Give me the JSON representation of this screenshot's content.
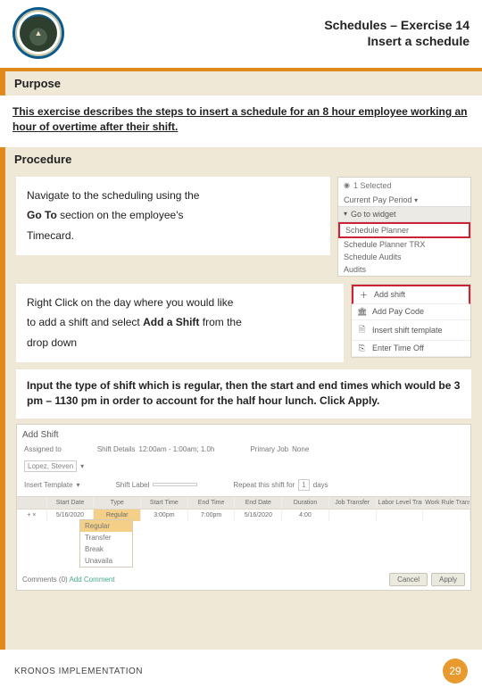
{
  "header": {
    "title_line1": "Schedules – Exercise 14",
    "title_line2": "Insert a schedule"
  },
  "sections": {
    "purpose_label": "Purpose",
    "purpose_text": "This exercise describes the steps to insert a schedule for an 8 hour employee working an hour of overtime after their shift.",
    "procedure_label": "Procedure"
  },
  "steps": {
    "s1a": "Navigate to the scheduling using the",
    "s1b": "Go To",
    "s1c": " section on the employee's",
    "s1d": "Timecard.",
    "s2a": "Right Click on the day where you would like",
    "s2b": "to add a shift and select ",
    "s2c": "Add a Shift",
    "s2d": " from the",
    "s2e": "drop down",
    "s3": "Input the type of shift which is regular, then the start and end times which would be 3 pm – 1130 pm in order to account for the half hour lunch. Click Apply."
  },
  "ss1": {
    "selected": "1 Selected",
    "period": "Current Pay Period",
    "goto": "Go to widget",
    "items": [
      "Schedule Planner",
      "Schedule Planner TRX",
      "Schedule Audits",
      "Audits"
    ]
  },
  "ss2": {
    "items": [
      {
        "icon": "＋",
        "label": "Add shift"
      },
      {
        "icon": "🏛",
        "label": "Add Pay Code"
      },
      {
        "icon": "🗎",
        "label": "Insert shift template"
      },
      {
        "icon": "⎘",
        "label": "Enter Time Off"
      }
    ]
  },
  "ss3": {
    "title": "Add Shift",
    "assigned_label": "Assigned to",
    "assigned_value": "Lopez, Steven",
    "details_label": "Shift Details",
    "details_value": "12:00am - 1:00am; 1.0h",
    "primary_label": "Primary Job",
    "primary_value": "None",
    "template_label": "Insert Template",
    "shift_label_lbl": "Shift Label",
    "repeat_label": "Repeat this shift for",
    "repeat_value": "1",
    "days": "days",
    "cols": [
      "",
      "Start Date",
      "Type",
      "Start Time",
      "End Time",
      "End Date",
      "Duration",
      "Job Transfer",
      "Labor Level Transfer",
      "Work Rule Transfer"
    ],
    "row": [
      "+  ×",
      "5/16/2020",
      "Regular",
      "3:00pm",
      "7:00pm",
      "5/16/2020",
      "4:00",
      "",
      "",
      ""
    ],
    "dropdown": [
      "Regular",
      "Transfer",
      "Break",
      "Unavaila"
    ],
    "comments_label": "Comments (0)",
    "add_comment": "Add Comment",
    "cancel": "Cancel",
    "apply": "Apply"
  },
  "footer": {
    "label": "KRONOS IMPLEMENTATION",
    "page": "29"
  }
}
